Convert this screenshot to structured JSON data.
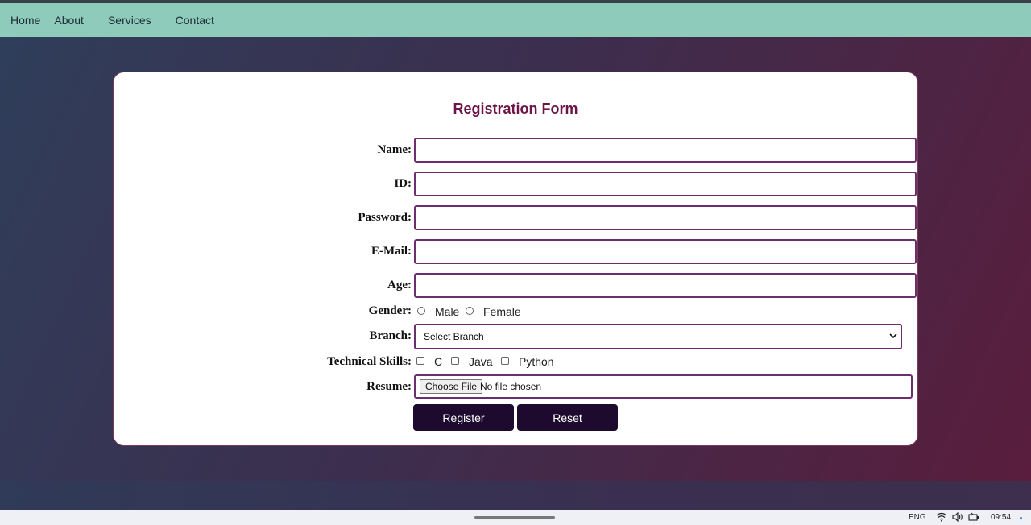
{
  "nav": {
    "items": [
      "Home",
      "About",
      "Services",
      "Contact"
    ]
  },
  "form": {
    "title": "Registration Form",
    "labels": {
      "name": "Name:",
      "id": "ID:",
      "password": "Password:",
      "email": "E-Mail:",
      "age": "Age:",
      "gender": "Gender:",
      "branch": "Branch:",
      "skills": "Technical Skills:",
      "resume": "Resume:"
    },
    "values": {
      "name": "",
      "id": "",
      "password": "",
      "email": "",
      "age": ""
    },
    "gender_options": [
      "Male",
      "Female"
    ],
    "branch_selected": "Select Branch",
    "skill_options": [
      "C",
      "Java",
      "Python"
    ],
    "file_button": "Choose File",
    "file_status": "No file chosen",
    "register_label": "Register",
    "reset_label": "Reset"
  },
  "taskbar": {
    "language": "ENG",
    "time": "09:54"
  },
  "colors": {
    "nav_bg": "#8ecbba",
    "title": "#6b1548",
    "input_border": "#6a2f6c",
    "button_bg": "#1d0a2e"
  }
}
